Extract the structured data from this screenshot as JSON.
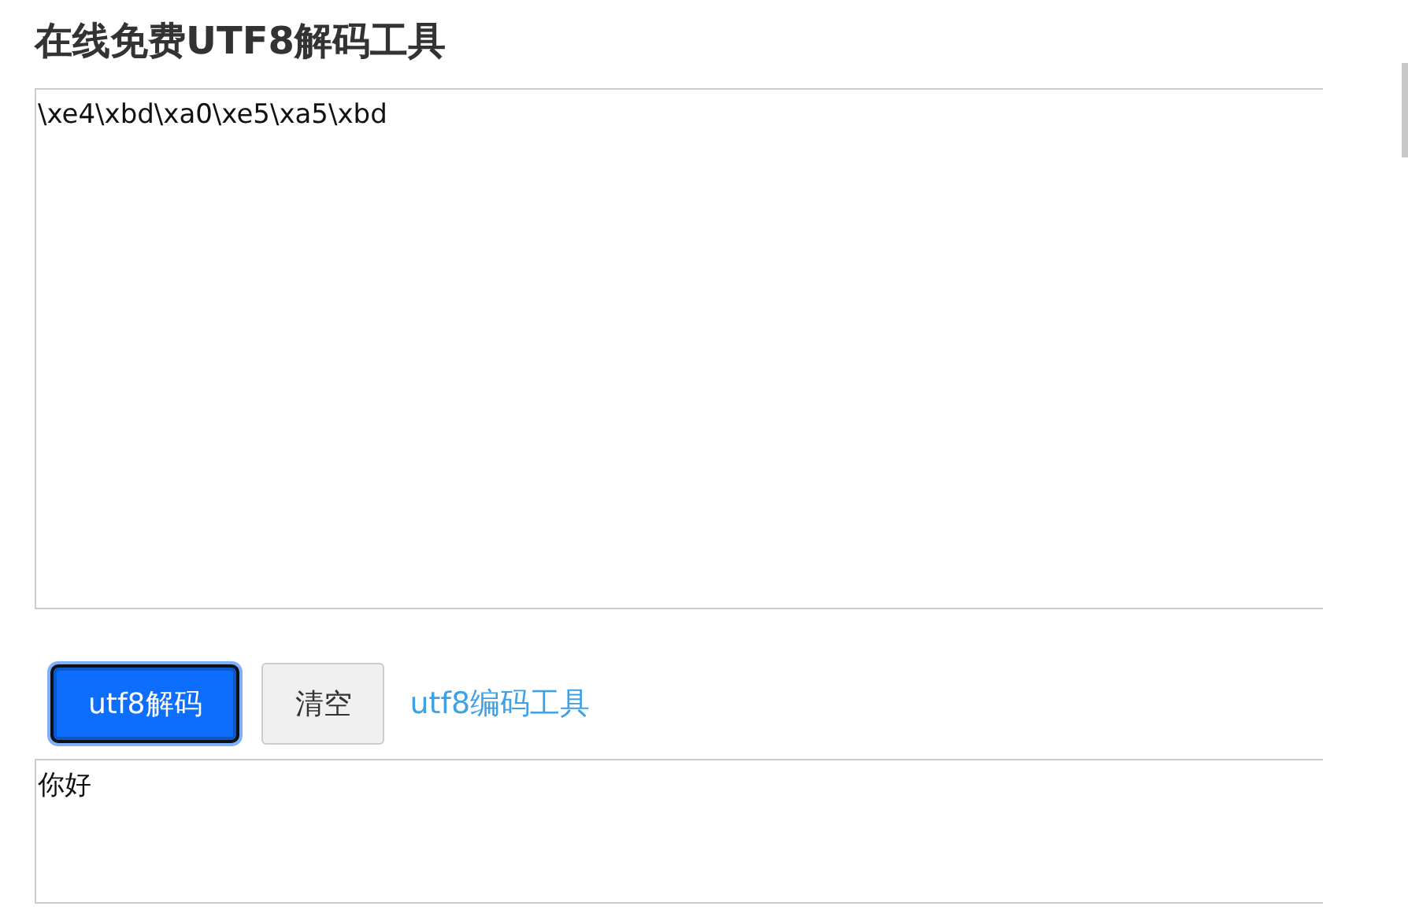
{
  "title": "在线免费UTF8解码工具",
  "input": {
    "value": "\\xe4\\xbd\\xa0\\xe5\\xa5\\xbd"
  },
  "buttons": [
    {
      "label": "utf8解码",
      "kind": "primary",
      "focused": true
    },
    {
      "label": "清空",
      "kind": "default",
      "focused": false
    }
  ],
  "link": {
    "label": "utf8编码工具"
  },
  "output": {
    "value": "你好"
  }
}
